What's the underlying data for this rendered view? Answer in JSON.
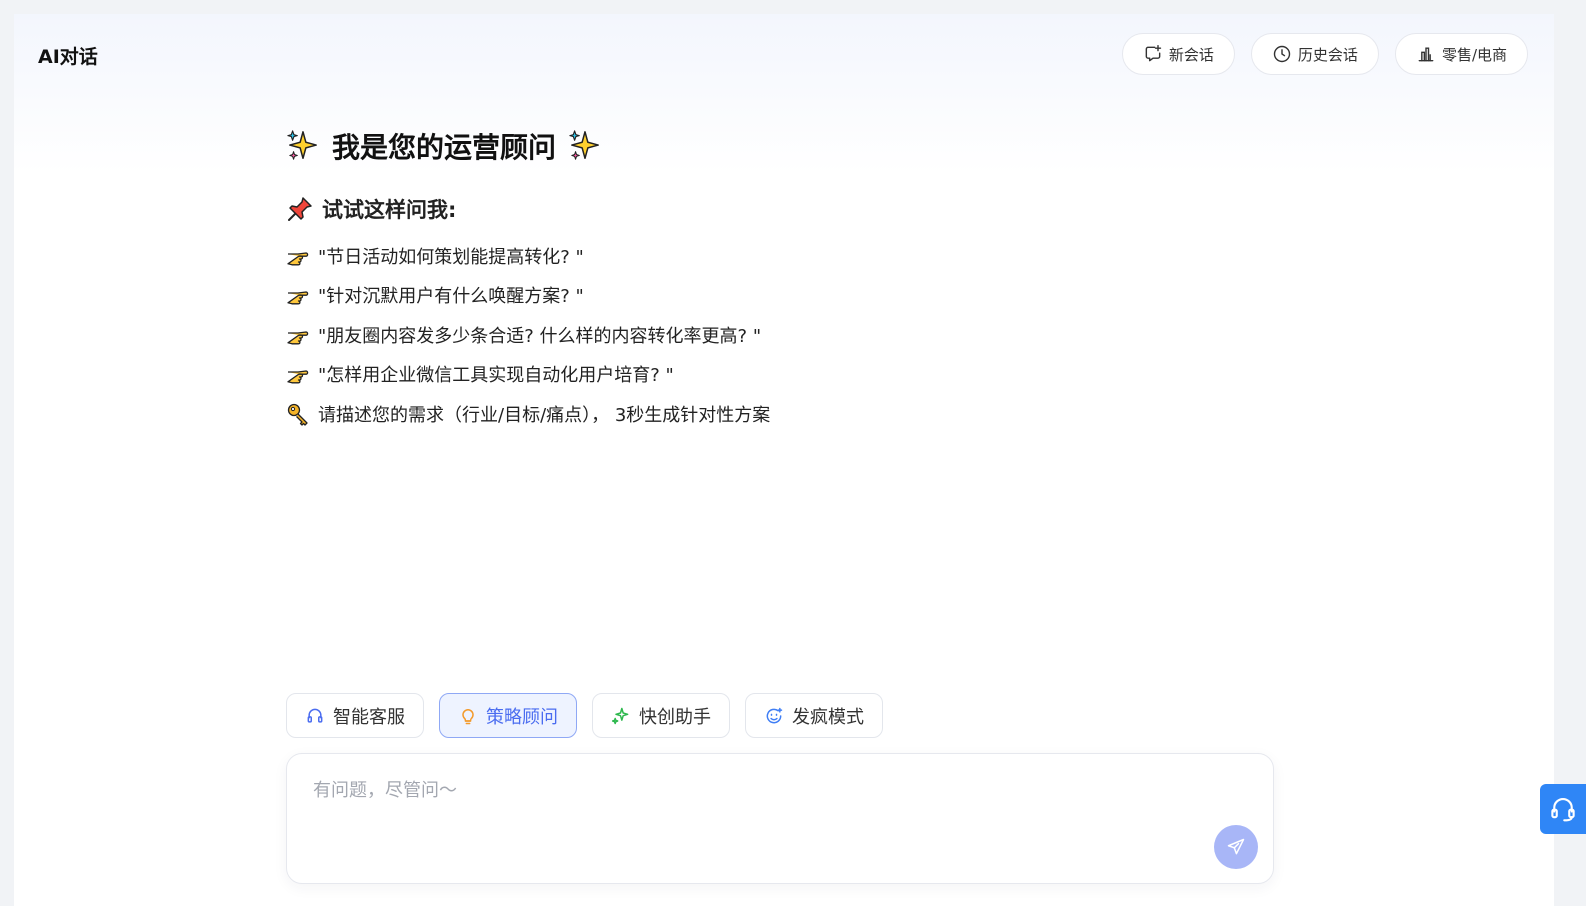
{
  "header": {
    "title": "AI对话",
    "actions": [
      {
        "label": "新会话",
        "icon": "chat-plus-icon"
      },
      {
        "label": "历史会话",
        "icon": "clock-icon"
      },
      {
        "label": "零售/电商",
        "icon": "bar-chart-icon"
      }
    ]
  },
  "welcome": {
    "title": "我是您的运营顾问",
    "title_icon": "sparkles-icon",
    "subtitle": "试试这样问我:",
    "subtitle_icon": "pushpin-icon",
    "examples": [
      "\"节日活动如何策划能提高转化? \"",
      "\"针对沉默用户有什么唤醒方案? \"",
      "\"朋友圈内容发多少条合适? 什么样的内容转化率更高? \"",
      "\"怎样用企业微信工具实现自动化用户培育? \""
    ],
    "example_icon": "pointing-hand-icon",
    "hint": "请描述您的需求（行业/目标/痛点）， 3秒生成针对性方案",
    "hint_icon": "key-icon"
  },
  "modes": [
    {
      "label": "智能客服",
      "icon": "headset-icon",
      "active": false,
      "color": "#4a6cf0"
    },
    {
      "label": "策略顾问",
      "icon": "lightbulb-icon",
      "active": true,
      "color": "#f39a2b"
    },
    {
      "label": "快创助手",
      "icon": "sparkle-icon",
      "active": false,
      "color": "#2db84d"
    },
    {
      "label": "发疯模式",
      "icon": "emoji-icon",
      "active": false,
      "color": "#3f7ef5"
    }
  ],
  "input": {
    "placeholder": "有问题，尽管问～",
    "value": ""
  },
  "colors": {
    "accent": "#4a6cf0",
    "send_button": "#a8b6f7",
    "support_button": "#2f86f6"
  },
  "float_button_icon": "headset-icon"
}
